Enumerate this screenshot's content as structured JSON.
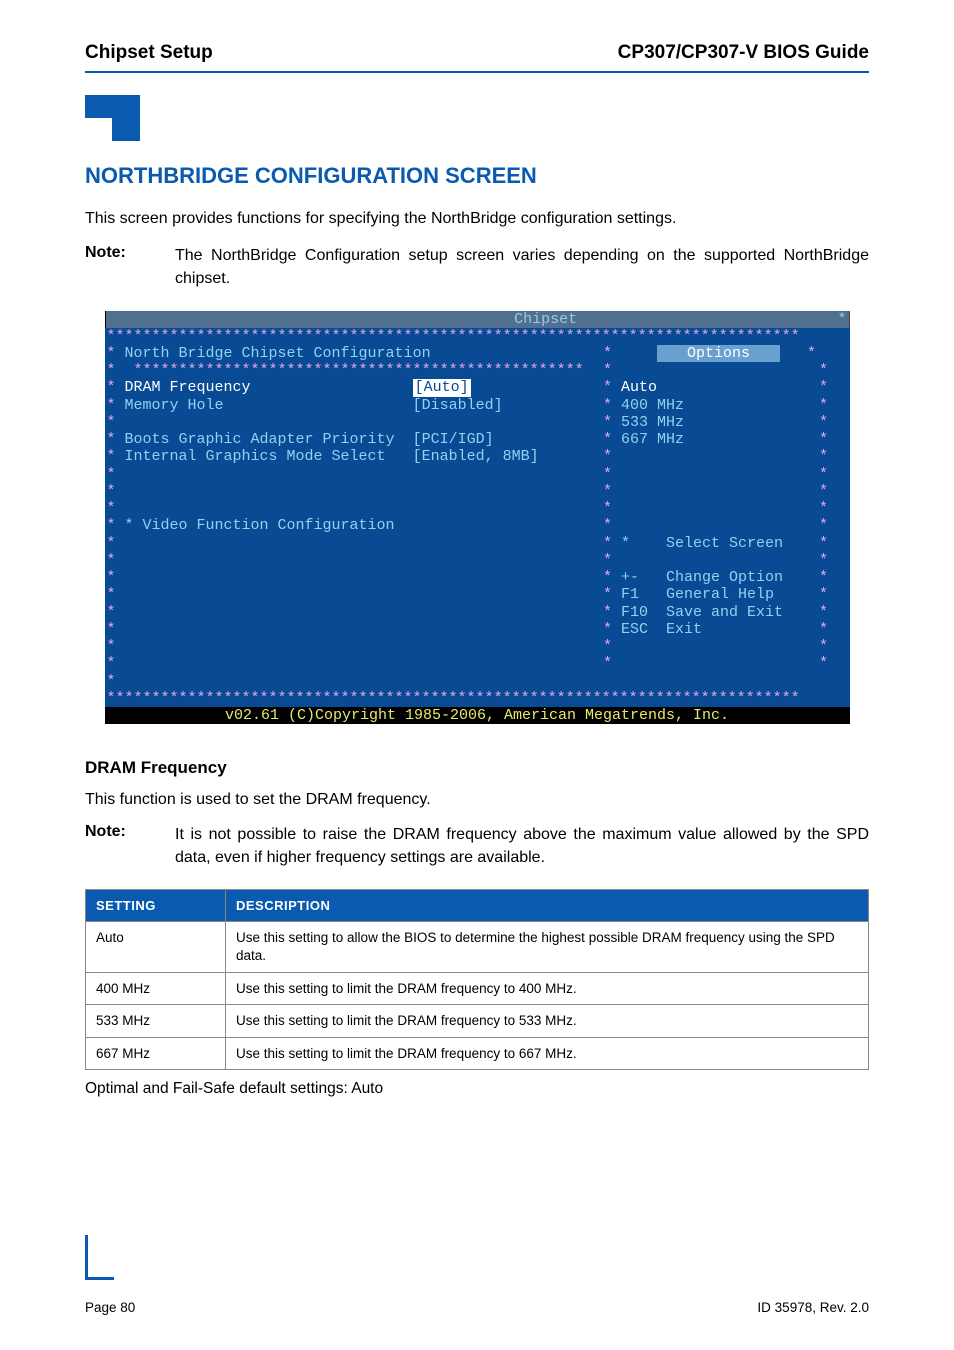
{
  "header": {
    "left": "Chipset Setup",
    "right": "CP307/CP307-V BIOS Guide"
  },
  "title": "NORTHBRIDGE CONFIGURATION SCREEN",
  "intro": "This screen provides functions for specifying the NorthBridge configuration settings.",
  "note1": {
    "label": "Note:",
    "text": "The NorthBridge Configuration setup screen varies depending on the supported NorthBridge chipset."
  },
  "bios": {
    "tab": "Chipset",
    "heading": "North Bridge Chipset Configuration",
    "options_label": "Options",
    "items": [
      {
        "name": "DRAM Frequency",
        "value": "[Auto]"
      },
      {
        "name": "Memory Hole",
        "value": "[Disabled]"
      },
      {
        "name": "Boots Graphic Adapter Priority",
        "value": "[PCI/IGD]"
      },
      {
        "name": "Internal Graphics Mode Select",
        "value": "[Enabled, 8MB]"
      }
    ],
    "submenu": "* Video Function Configuration",
    "options": [
      "Auto",
      "400 MHz",
      "533 MHz",
      "667 MHz"
    ],
    "help": [
      {
        "key": "*",
        "text": "Select Screen"
      },
      {
        "key": "+-",
        "text": "Change Option"
      },
      {
        "key": "F1",
        "text": "General Help"
      },
      {
        "key": "F10",
        "text": "Save and Exit"
      },
      {
        "key": "ESC",
        "text": "Exit"
      }
    ],
    "footer": "v02.61 (C)Copyright 1985-2006, American Megatrends, Inc."
  },
  "section": {
    "title": "DRAM Frequency",
    "desc": "This function is used to set the DRAM frequency."
  },
  "note2": {
    "label": "Note:",
    "text": "It is not possible to raise the DRAM frequency above the maximum value allowed by the SPD data, even if higher frequency settings are available."
  },
  "table": {
    "headers": [
      "SETTING",
      "DESCRIPTION"
    ],
    "rows": [
      {
        "setting": "Auto",
        "desc": "Use this setting to allow the BIOS to determine the highest possible DRAM frequency using the SPD data."
      },
      {
        "setting": "400 MHz",
        "desc": "Use this setting to limit the DRAM frequency to 400 MHz."
      },
      {
        "setting": "533 MHz",
        "desc": "Use this setting to limit the DRAM frequency to 533 MHz."
      },
      {
        "setting": "667 MHz",
        "desc": "Use this setting to limit the DRAM frequency to 667 MHz."
      }
    ]
  },
  "after_table": "Optimal and Fail-Safe default settings: Auto",
  "footer": {
    "left": "Page 80",
    "right": "ID 35978, Rev. 2.0"
  }
}
